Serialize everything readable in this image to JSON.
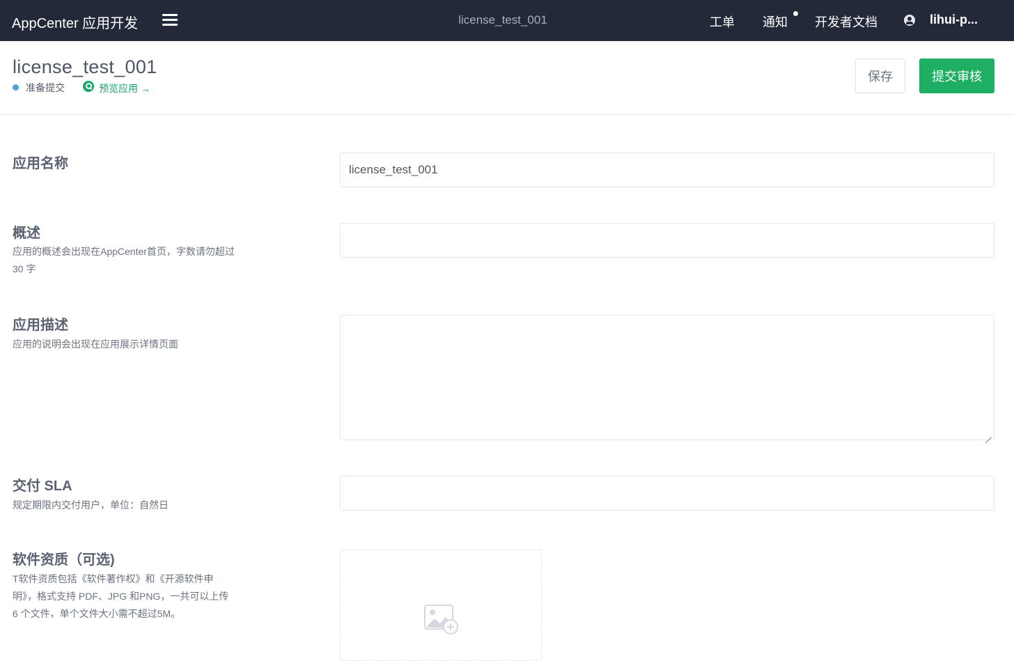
{
  "topbar": {
    "brand": "AppCenter 应用开发",
    "center_title": "license_test_001",
    "nav": {
      "tickets": "工单",
      "notifications": "通知",
      "docs": "开发者文档",
      "user": "lihui-p..."
    }
  },
  "header": {
    "title": "license_test_001",
    "status": "准备提交",
    "preview_link": "预览应用 →",
    "save_label": "保存",
    "submit_label": "提交审核"
  },
  "form": {
    "app_name": {
      "label": "应用名称",
      "value": "license_test_001"
    },
    "summary": {
      "label": "概述",
      "help": "应用的概述会出现在AppCenter首页，字数请勿超过 30 字",
      "value": ""
    },
    "description": {
      "label": "应用描述",
      "help": "应用的说明会出现在应用展示详情页面",
      "value": ""
    },
    "sla": {
      "label": "交付 SLA",
      "help": "规定期限内交付用户，单位：自然日",
      "value": ""
    },
    "qualification": {
      "label": "软件资质（可选)",
      "help": "T软件资质包括《软件著作权》和《开源软件申明》，格式支持 PDF、JPG 和PNG，一共可以上传 6 个文件，单个文件大小需不超过5M。"
    }
  },
  "colors": {
    "topbar_bg": "#222938",
    "primary": "#1faf62",
    "link": "#16a86a",
    "status_dot": "#4fa3d6"
  },
  "icons": {
    "menu": "menu-icon",
    "user": "user-icon",
    "preview": "search-icon",
    "upload": "image-add-icon"
  }
}
